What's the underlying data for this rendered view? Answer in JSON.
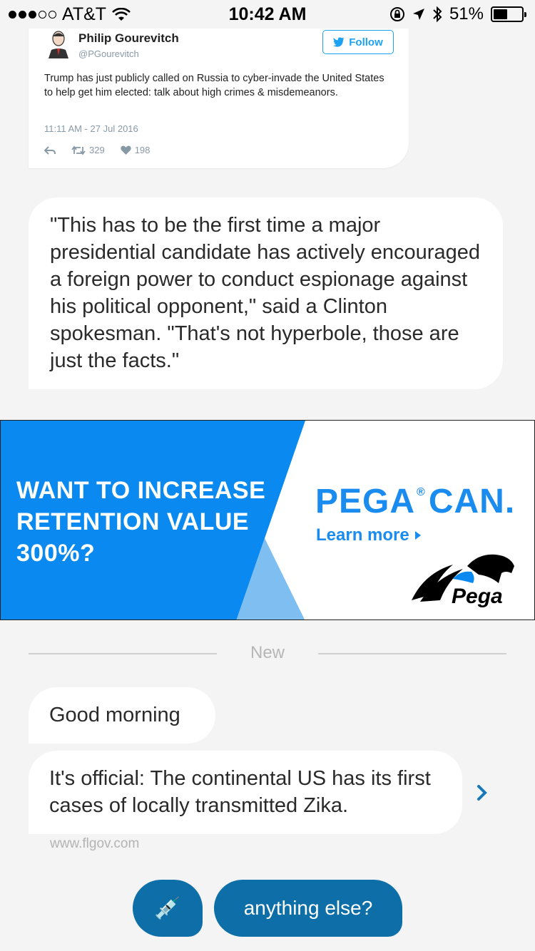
{
  "status_bar": {
    "carrier": "AT&T",
    "time": "10:42 AM",
    "battery": "51%",
    "battery_level": 0.51
  },
  "tweet": {
    "name": "Philip Gourevitch",
    "handle": "@PGourevitch",
    "follow_label": "Follow",
    "text": "Trump has just publicly called on Russia to cyber-invade the United States to help get him elected: talk about high crimes & misdemeanors.",
    "datetime": "11:11 AM - 27 Jul 2016",
    "retweets": "329",
    "likes": "198"
  },
  "quote_message": "\"This has to be the first time a major presidential candidate has actively encouraged a foreign power to conduct espionage against his political opponent,\" said a Clinton spokesman. \"That's not hyperbole, those are just the facts.\"",
  "ad": {
    "headline": "WANT TO INCREASE RETENTION VALUE 300%?",
    "brand_word": "PEGA",
    "brand_mark": "®",
    "brand_tail": "CAN.",
    "cta": "Learn more",
    "logo_text": "Pega",
    "colors": {
      "blue": "#0a8af0",
      "light_blue": "#7fbef0"
    }
  },
  "divider_label": "New",
  "messages": {
    "greeting": "Good morning",
    "story": "It's official: The continental US has its first cases of locally transmitted Zika.",
    "source": "www.flgov.com"
  },
  "replies": {
    "emoji_icon": "syringe-icon",
    "emoji": "💉",
    "anything_else": "anything else?"
  }
}
